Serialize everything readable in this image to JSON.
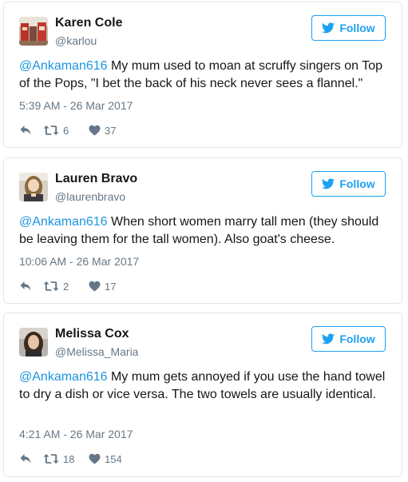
{
  "colors": {
    "link": "#1b95e0",
    "follow": "#1da1f2",
    "meta": "#657786",
    "border": "#e1e8ed"
  },
  "tweets": [
    {
      "name": "Karen Cole",
      "handle": "@karlou",
      "follow_label": "Follow",
      "mention": "@Ankaman616",
      "text": " My mum used to moan at scruffy singers on Top of the Pops, \"I bet the back of his neck never sees a flannel.\"",
      "timestamp": "5:39 AM - 26 Mar 2017",
      "retweets": "6",
      "likes": "37"
    },
    {
      "name": "Lauren Bravo",
      "handle": "@laurenbravo",
      "follow_label": "Follow",
      "mention": "@Ankaman616",
      "text": " When short women marry tall men (they should be leaving them for the tall women). Also goat's cheese.",
      "timestamp": "10:06 AM - 26 Mar 2017",
      "retweets": "2",
      "likes": "17"
    },
    {
      "name": "Melissa Cox",
      "handle": "@Melissa_Maria",
      "follow_label": "Follow",
      "mention": "@Ankaman616",
      "text": " My mum gets annoyed if you use the hand towel to dry a dish or vice versa. The two towels are usually identical.",
      "timestamp": "4:21 AM - 26 Mar 2017",
      "retweets": "18",
      "likes": "154"
    }
  ]
}
